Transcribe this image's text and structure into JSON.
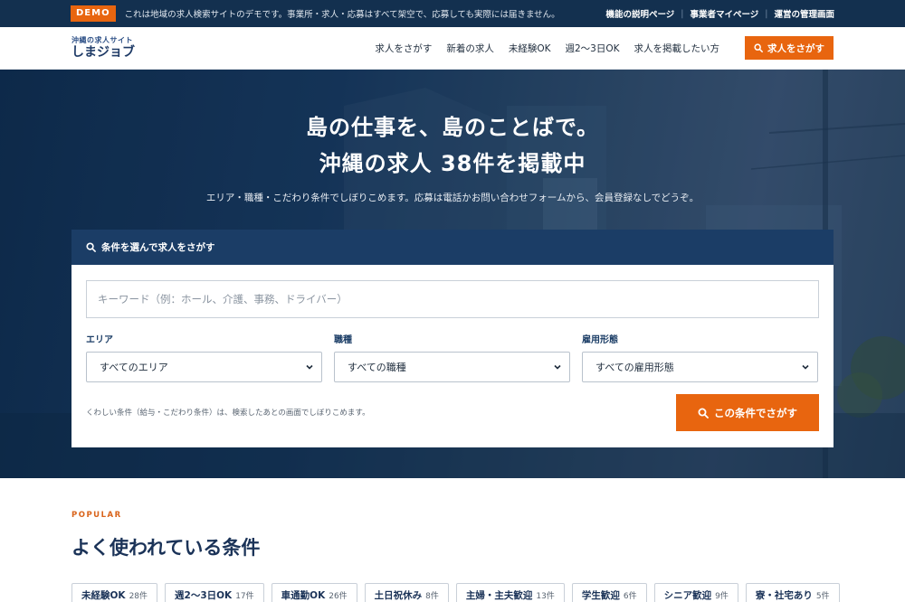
{
  "demo_bar": {
    "badge": "DEMO",
    "notice": "これは地域の求人検索サイトのデモです。事業所・求人・応募はすべて架空で、応募しても実際には届きません。",
    "links": [
      "機能の説明ページ",
      "事業者マイページ",
      "運営の管理画面"
    ]
  },
  "header": {
    "logo_sub": "沖縄の求人サイト",
    "logo_main": "しまジョブ",
    "nav": [
      "求人をさがす",
      "新着の求人",
      "未経験OK",
      "週2〜3日OK",
      "求人を掲載したい方"
    ],
    "cta": "求人をさがす"
  },
  "hero": {
    "title_line1": "島の仕事を、島のことばで。",
    "title_line2": "沖縄の求人 38件を掲載中",
    "lead": "エリア・職種・こだわり条件でしぼりこめます。応募は電話かお問い合わせフォームから、会員登録なしでどうぞ。"
  },
  "search_card": {
    "heading": "条件を選んで求人をさがす",
    "keyword_placeholder": "キーワード（例：ホール、介護、事務、ドライバー）",
    "fields": [
      {
        "label": "エリア",
        "selected": "すべてのエリア"
      },
      {
        "label": "職種",
        "selected": "すべての職種"
      },
      {
        "label": "雇用形態",
        "selected": "すべての雇用形態"
      }
    ],
    "note": "くわしい条件（給与・こだわり条件）は、検索したあとの画面でしぼりこめます。",
    "submit": "この条件でさがす"
  },
  "popular": {
    "eyebrow": "POPULAR",
    "title": "よく使われている条件",
    "chips": [
      {
        "label": "未経験OK",
        "count": "28件"
      },
      {
        "label": "週2〜3日OK",
        "count": "17件"
      },
      {
        "label": "車通勤OK",
        "count": "26件"
      },
      {
        "label": "土日祝休み",
        "count": "8件"
      },
      {
        "label": "主婦・主夫歓迎",
        "count": "13件"
      },
      {
        "label": "学生歓迎",
        "count": "6件"
      },
      {
        "label": "シニア歓迎",
        "count": "9件"
      },
      {
        "label": "寮・社宅あり",
        "count": "5件"
      }
    ]
  },
  "colors": {
    "brand_navy": "#13304f",
    "accent_orange": "#e8650f",
    "card_head": "#1b3d66"
  }
}
